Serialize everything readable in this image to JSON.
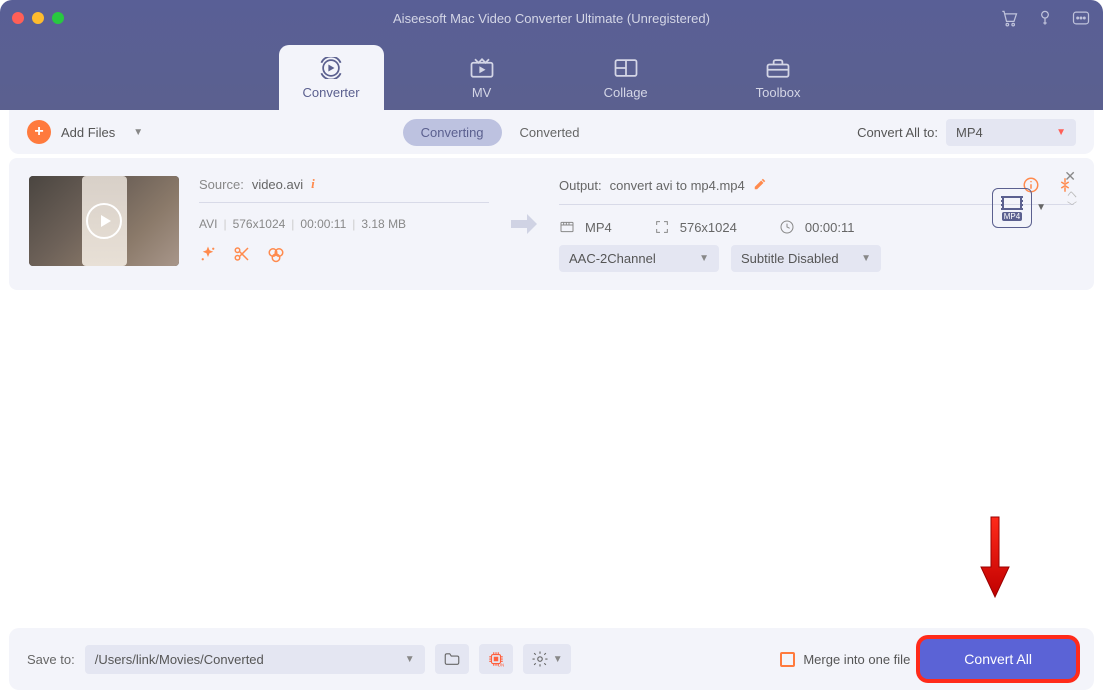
{
  "window": {
    "title": "Aiseesoft Mac Video Converter Ultimate (Unregistered)"
  },
  "tabs": {
    "converter": "Converter",
    "mv": "MV",
    "collage": "Collage",
    "toolbox": "Toolbox"
  },
  "toolbar": {
    "add_files": "Add Files",
    "segmented": {
      "converting": "Converting",
      "converted": "Converted"
    },
    "convert_all_to_label": "Convert All to:",
    "convert_all_to_value": "MP4"
  },
  "item": {
    "source_label": "Source:",
    "source_file": "video.avi",
    "meta": {
      "codec": "AVI",
      "res": "576x1024",
      "dur": "00:00:11",
      "size": "3.18 MB"
    },
    "output_label": "Output:",
    "output_file": "convert avi to mp4.mp4",
    "out": {
      "format": "MP4",
      "res": "576x1024",
      "dur": "00:00:11"
    },
    "audio_select": "AAC-2Channel",
    "subtitle_select": "Subtitle Disabled",
    "format_badge": "MP4"
  },
  "footer": {
    "save_to_label": "Save to:",
    "save_to_path": "/Users/link/Movies/Converted",
    "merge_label": "Merge into one file",
    "convert_all": "Convert All"
  }
}
